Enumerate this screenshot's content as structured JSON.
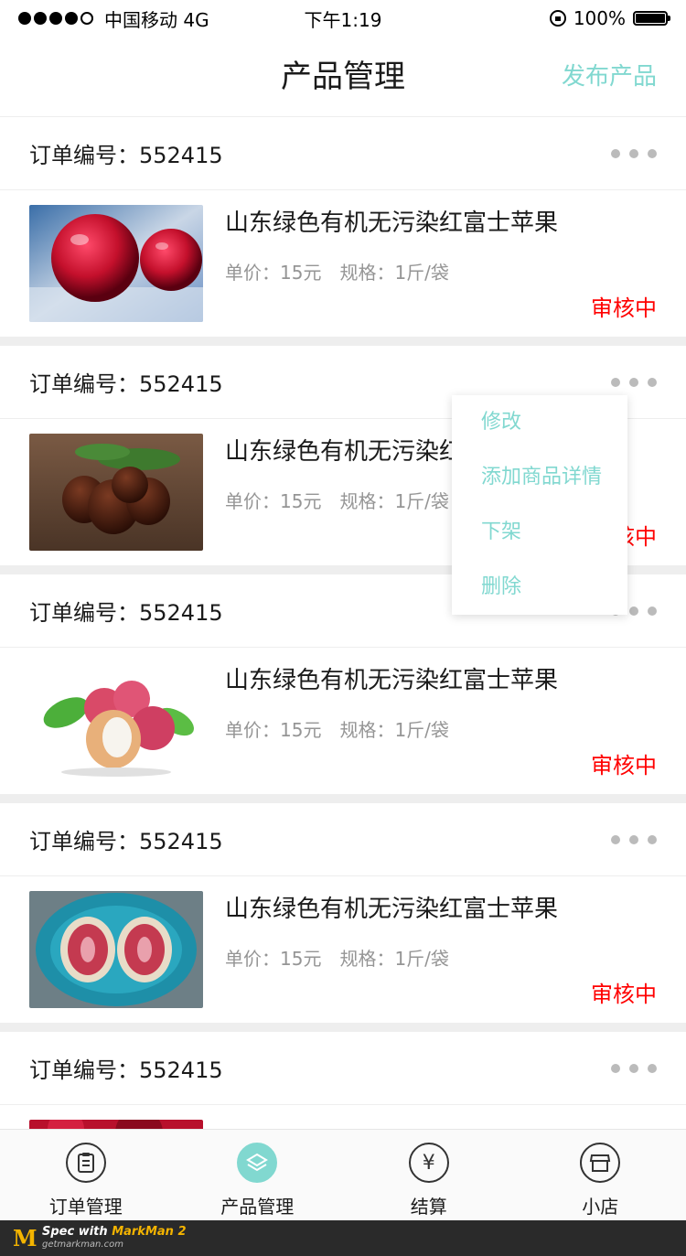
{
  "status_bar": {
    "carrier": "中国移动 4G",
    "time": "下午1:19",
    "battery": "100%"
  },
  "nav": {
    "title": "产品管理",
    "publish_label": "发布产品"
  },
  "orders": [
    {
      "order_label": "订单编号：552415",
      "name": "山东绿色有机无污染红富士苹果",
      "price": "单价：15元",
      "spec": "规格：1斤/袋",
      "status": "审核中",
      "image": "apple-image"
    },
    {
      "order_label": "订单编号：552415",
      "name": "山东绿色有机无污染红富士苹果",
      "price": "单价：15元",
      "spec": "规格：1斤/袋",
      "status": "审核中",
      "image": "chestnut-image"
    },
    {
      "order_label": "订单编号：552415",
      "name": "山东绿色有机无污染红富士苹果",
      "price": "单价：15元",
      "spec": "规格：1斤/袋",
      "status": "审核中",
      "image": "lychee-image"
    },
    {
      "order_label": "订单编号：552415",
      "name": "山东绿色有机无污染红富士苹果",
      "price": "单价：15元",
      "spec": "规格：1斤/袋",
      "status": "审核中",
      "image": "fig-image"
    },
    {
      "order_label": "订单编号：552415",
      "name": "",
      "price": "",
      "spec": "",
      "status": "",
      "image": "partial-image"
    }
  ],
  "dropdown": {
    "items": [
      "修改",
      "添加商品详情",
      "下架",
      "删除"
    ]
  },
  "tabs": [
    {
      "label": "订单管理",
      "icon": "clipboard-icon",
      "active": false
    },
    {
      "label": "产品管理",
      "icon": "layers-icon",
      "active": true
    },
    {
      "label": "结算",
      "icon": "yuan-icon",
      "active": false
    },
    {
      "label": "小店",
      "icon": "shop-icon",
      "active": false
    }
  ],
  "footer": {
    "line1_prefix": "Spec with ",
    "line1_brand": "MarkMan 2",
    "line2": "getmarkman.com"
  },
  "colors": {
    "accent": "#81d8d0",
    "status": "#ff0000",
    "text": "#1b1b1b",
    "muted": "#959595",
    "divider": "#eeeeee"
  }
}
